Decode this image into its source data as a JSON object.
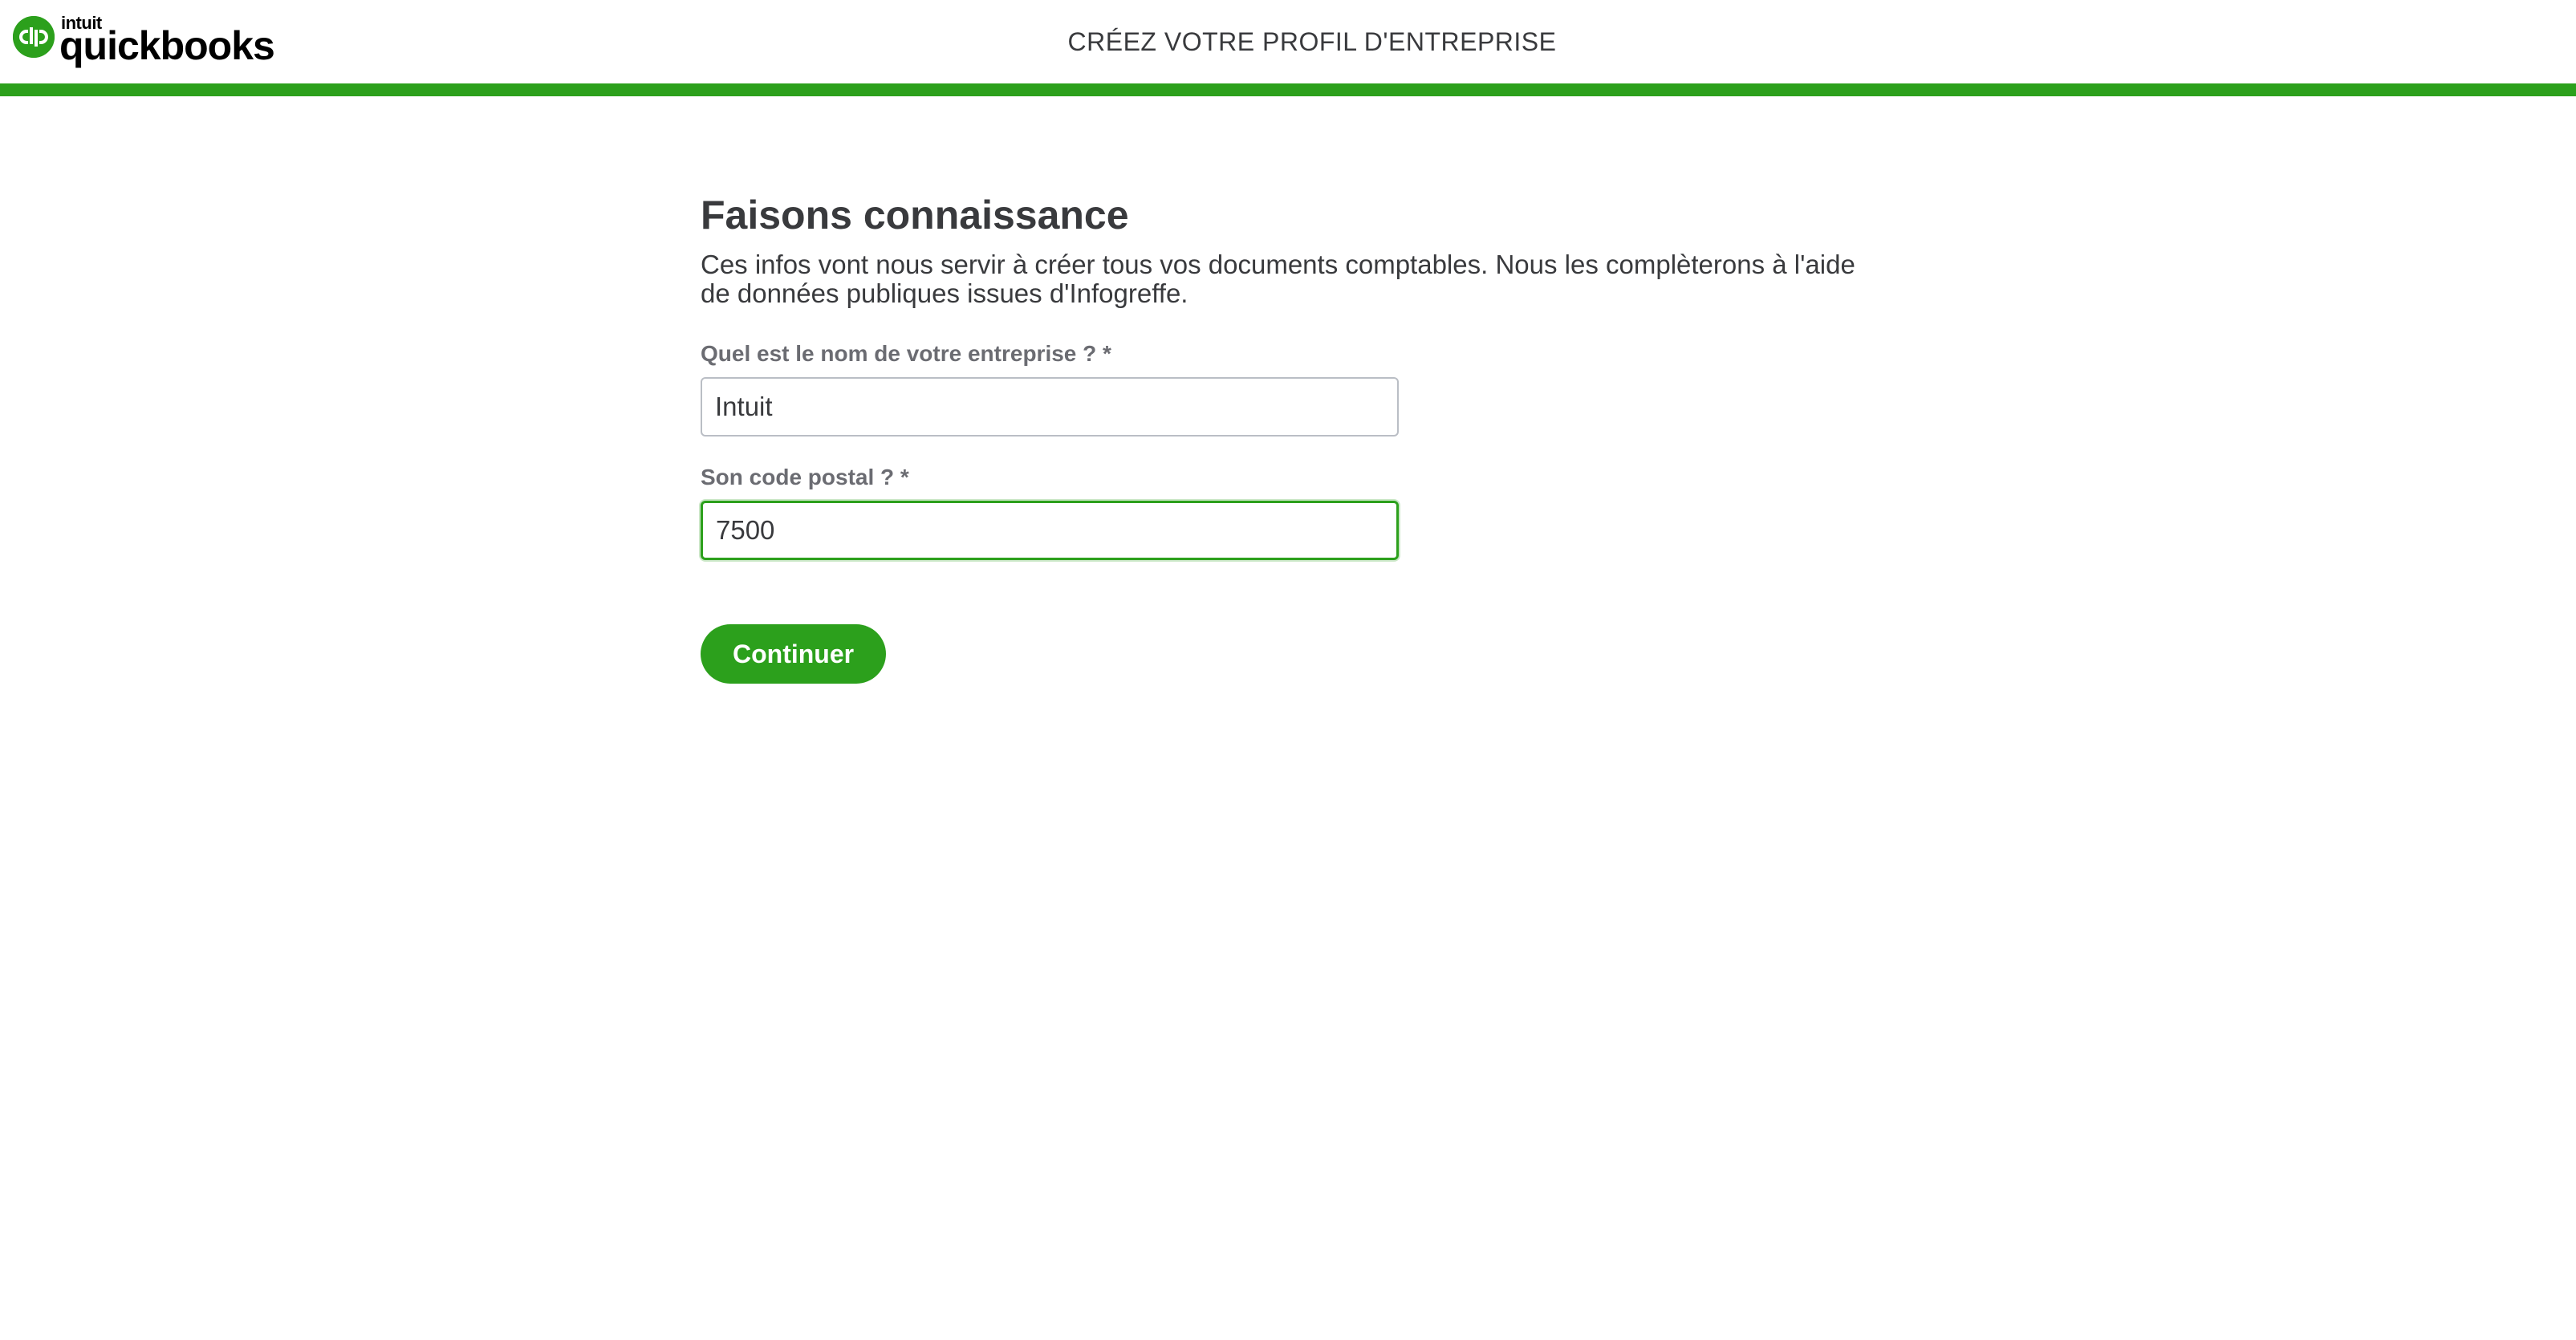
{
  "header": {
    "logo": {
      "brand_top": "intuit",
      "brand_main": "quickbooks",
      "icon": "quickbooks-logo-icon"
    },
    "title": "CRÉEZ VOTRE PROFIL D'ENTREPRISE",
    "progress_color": "#2ca01c"
  },
  "main": {
    "title": "Faisons connaissance",
    "intro": "Ces infos vont nous servir à créer tous vos documents comptables. Nous les complèterons à l'aide de données publiques issues d'Infogreffe.",
    "fields": [
      {
        "label": "Quel est le nom de votre entreprise ? *",
        "value": "Intuit",
        "focused": false
      },
      {
        "label": "Son code postal ? *",
        "value": "7500",
        "focused": true
      }
    ],
    "continue_label": "Continuer"
  },
  "colors": {
    "accent": "#2ca01c",
    "text": "#393a3d",
    "label": "#6b6c72",
    "input_border": "#babec5"
  }
}
